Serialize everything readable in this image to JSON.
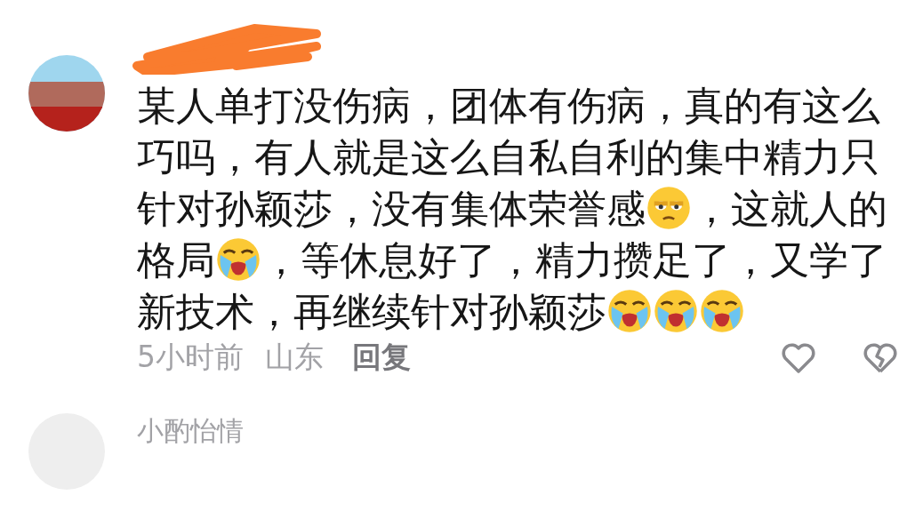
{
  "comment": {
    "segments": [
      {
        "kind": "text",
        "text": "某人单打没伤病，团体有伤病，真的有这么巧吗，有人就是这么自私自利的集中精力只针对孙颖莎，没有集体荣誉感"
      },
      {
        "kind": "eyeroll-emoji"
      },
      {
        "kind": "text",
        "text": "，这就人的格局"
      },
      {
        "kind": "crying-emoji"
      },
      {
        "kind": "text",
        "text": "，等休息好了，精力攒足了，又学了新技术，再继续针对孙颖莎"
      },
      {
        "kind": "crying-emoji"
      },
      {
        "kind": "crying-emoji"
      },
      {
        "kind": "crying-emoji"
      }
    ],
    "time": "5小时前",
    "location": "山东",
    "reply": "回复"
  },
  "next_comment": {
    "username": "小酌怡情"
  }
}
